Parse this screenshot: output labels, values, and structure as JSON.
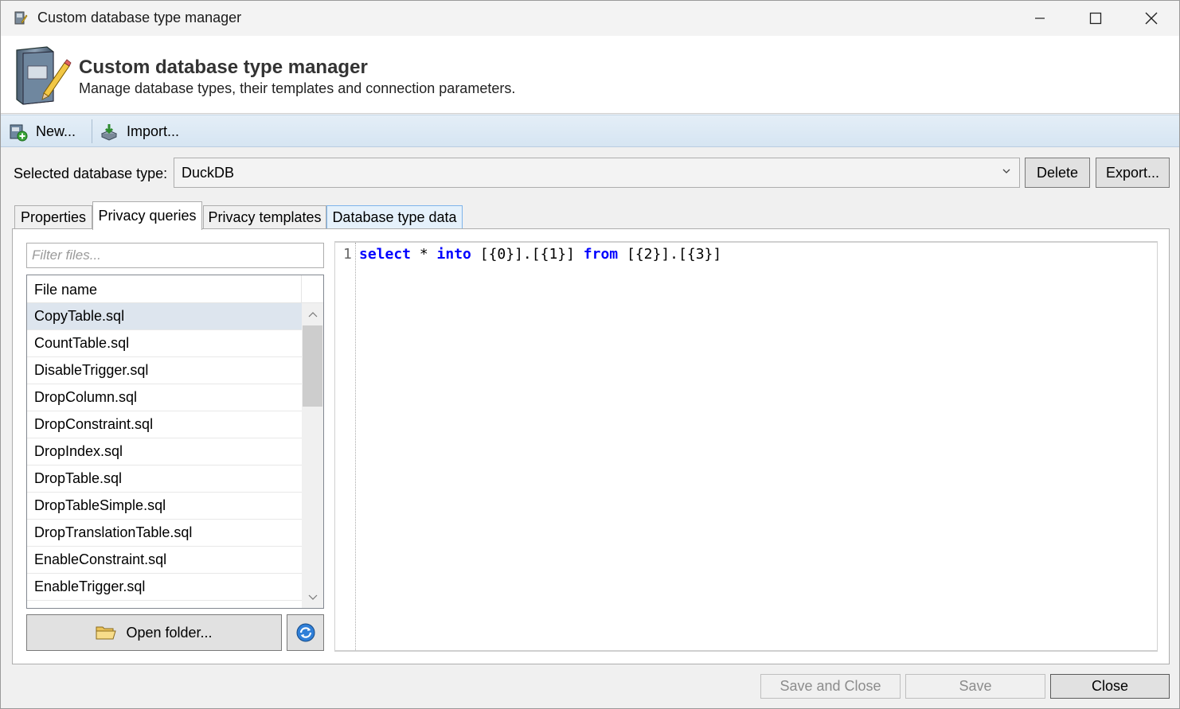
{
  "window": {
    "title": "Custom database type manager",
    "controls": [
      "minimize",
      "maximize",
      "close"
    ]
  },
  "header": {
    "title": "Custom database type manager",
    "subtitle": "Manage database types, their templates and connection parameters."
  },
  "toolbar": {
    "new_label": "New...",
    "import_label": "Import..."
  },
  "db_type": {
    "label": "Selected database type:",
    "selected": "DuckDB",
    "delete_label": "Delete",
    "export_label": "Export..."
  },
  "tabs": [
    {
      "label": "Properties",
      "active": false
    },
    {
      "label": "Privacy queries",
      "active": true
    },
    {
      "label": "Privacy templates",
      "active": false
    },
    {
      "label": "Database type data",
      "active": false
    }
  ],
  "files": {
    "filter_placeholder": "Filter files...",
    "column_header": "File name",
    "items": [
      "CopyTable.sql",
      "CountTable.sql",
      "DisableTrigger.sql",
      "DropColumn.sql",
      "DropConstraint.sql",
      "DropIndex.sql",
      "DropTable.sql",
      "DropTableSimple.sql",
      "DropTranslationTable.sql",
      "EnableConstraint.sql",
      "EnableTrigger.sql"
    ],
    "selected_index": 0,
    "open_folder_label": "Open folder..."
  },
  "editor": {
    "line_number": "1",
    "tokens": [
      {
        "text": "select",
        "kind": "kw"
      },
      {
        "text": " * ",
        "kind": "plain"
      },
      {
        "text": "into",
        "kind": "kw"
      },
      {
        "text": " [{0}].[{1}] ",
        "kind": "plain"
      },
      {
        "text": "from",
        "kind": "kw"
      },
      {
        "text": " [{2}].[{3}]",
        "kind": "plain"
      }
    ]
  },
  "footer": {
    "save_close_label": "Save and Close",
    "save_label": "Save",
    "close_label": "Close"
  }
}
